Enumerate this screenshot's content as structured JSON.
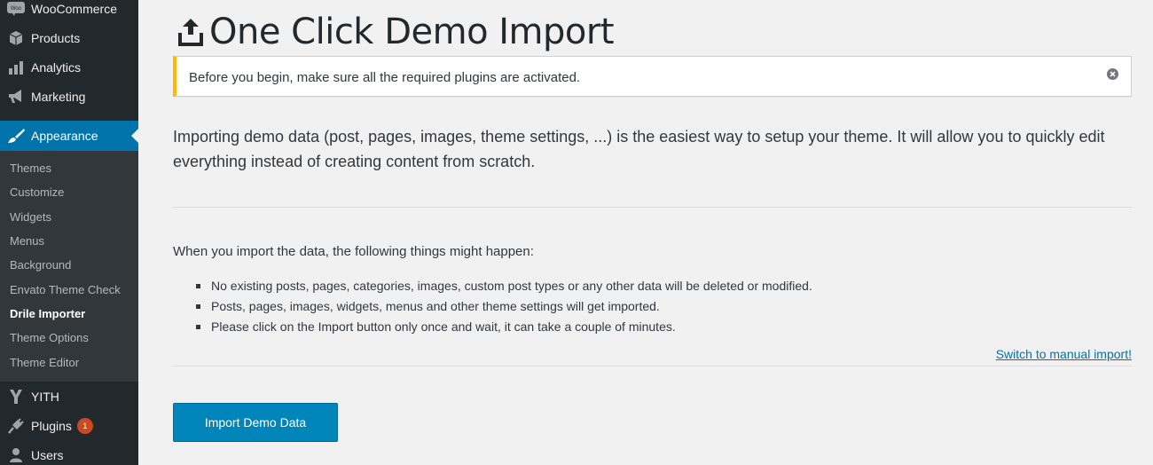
{
  "sidebar": {
    "top_items": [
      {
        "label": "WooCommerce",
        "icon": "woocommerce-icon"
      },
      {
        "label": "Products",
        "icon": "products-box-icon"
      },
      {
        "label": "Analytics",
        "icon": "analytics-bars-icon"
      },
      {
        "label": "Marketing",
        "icon": "megaphone-icon"
      }
    ],
    "active_item": {
      "label": "Appearance",
      "icon": "paintbrush-icon"
    },
    "submenu": [
      "Themes",
      "Customize",
      "Widgets",
      "Menus",
      "Background",
      "Envato Theme Check",
      "Drile Importer",
      "Theme Options",
      "Theme Editor"
    ],
    "current_submenu": "Drile Importer",
    "bottom_items": [
      {
        "label": "YITH",
        "icon": "yith-icon"
      },
      {
        "label": "Plugins",
        "icon": "plugins-plug-icon",
        "badge": "1"
      },
      {
        "label": "Users",
        "icon": "users-icon"
      }
    ],
    "woo_icon_text": "Woo"
  },
  "main": {
    "title": "One Click Demo Import",
    "notice": "Before you begin, make sure all the required plugins are activated.",
    "intro": "Importing demo data (post, pages, images, theme settings, ...) is the easiest way to setup your theme. It will allow you to quickly edit everything instead of creating content from scratch.",
    "when_text": "When you import the data, the following things might happen:",
    "bullets": [
      "No existing posts, pages, categories, images, custom post types or any other data will be deleted or modified.",
      "Posts, pages, images, widgets, menus and other theme settings will get imported.",
      "Please click on the Import button only once and wait, it can take a couple of minutes."
    ],
    "manual_link": "Switch to manual import!",
    "import_button": "Import Demo Data"
  },
  "colors": {
    "sidebar_bg": "#23282d",
    "submenu_bg": "#32373c",
    "accent": "#0073aa",
    "notice_warning": "#ffb900",
    "button_primary": "#0085ba",
    "badge": "#ca4a1f"
  }
}
